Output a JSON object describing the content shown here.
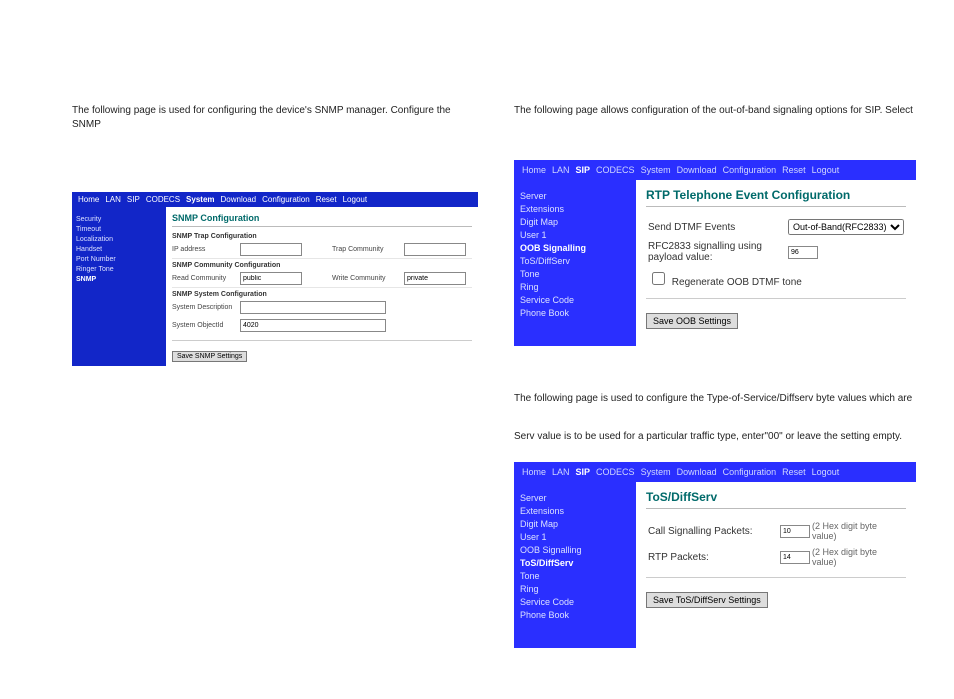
{
  "left": {
    "para": "The following page is used for configuring the device's SNMP manager. Configure the SNMP",
    "topbar": [
      "Home",
      "LAN",
      "SIP",
      "CODECS",
      "System",
      "Download",
      "Configuration",
      "Reset",
      "Logout"
    ],
    "topbar_active": "System",
    "sidebar": [
      "Security",
      "Timeout",
      "Localization",
      "Handset",
      "Port Number",
      "Ringer Tone",
      "SNMP"
    ],
    "sidebar_active": "SNMP",
    "title": "SNMP Configuration",
    "sect1": "SNMP Trap Configuration",
    "ip_label": "IP address",
    "trap_label": "Trap Community",
    "sect2": "SNMP Community Configuration",
    "read_label": "Read Community",
    "read_val": "public",
    "write_label": "Write Community",
    "write_val": "private",
    "sect3": "SNMP System Configuration",
    "sysdesc_label": "System Description",
    "sysoid_label": "System ObjectId",
    "sysoid_val": "4020",
    "save_btn": "Save SNMP Settings"
  },
  "right1": {
    "para": "The following page allows configuration of the out-of-band signaling options for SIP. Select",
    "topbar": [
      "Home",
      "LAN",
      "SIP",
      "CODECS",
      "System",
      "Download",
      "Configuration",
      "Reset",
      "Logout"
    ],
    "topbar_active": "SIP",
    "sidebar": [
      "Server",
      "Extensions",
      "Digit Map",
      "User 1",
      "OOB Signalling",
      "ToS/DiffServ",
      "Tone",
      "Ring",
      "Service Code",
      "Phone Book"
    ],
    "sidebar_active": "OOB Signalling",
    "title": "RTP Telephone Event Configuration",
    "dtmf_label": "Send DTMF Events",
    "dtmf_value": "Out-of-Band(RFC2833)",
    "payload_label": "RFC2833 signalling using payload value:",
    "payload_value": "96",
    "regen_label": "Regenerate OOB DTMF tone",
    "save_btn": "Save OOB Settings"
  },
  "right2": {
    "para1": "The following page is used to configure the Type-of-Service/Diffserv byte values which are",
    "para2": "Serv value is to be used for a particular traffic type, enter\"00\" or leave the setting empty.",
    "topbar": [
      "Home",
      "LAN",
      "SIP",
      "CODECS",
      "System",
      "Download",
      "Configuration",
      "Reset",
      "Logout"
    ],
    "topbar_active": "SIP",
    "sidebar": [
      "Server",
      "Extensions",
      "Digit Map",
      "User 1",
      "OOB Signalling",
      "ToS/DiffServ",
      "Tone",
      "Ring",
      "Service Code",
      "Phone Book"
    ],
    "sidebar_active": "ToS/DiffServ",
    "title": "ToS/DiffServ",
    "row1_label": "Call Signalling Packets:",
    "row1_val": "10",
    "row2_label": "RTP Packets:",
    "row2_val": "14",
    "hint": "(2 Hex digit byte value)",
    "save_btn": "Save ToS/DiffServ Settings"
  }
}
